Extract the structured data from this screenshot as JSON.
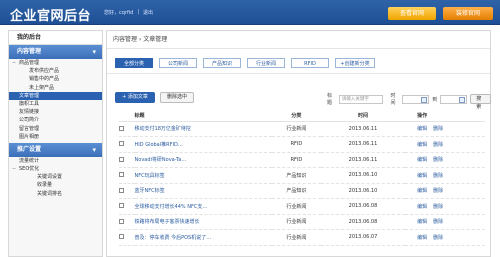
{
  "header": {
    "title": "企业官网后台",
    "user_greeting": "您好，",
    "user_name": "cqrfid",
    "logout": "退出",
    "view_site": "查看官网",
    "decorate_site": "装修官网"
  },
  "sidebar": {
    "title": "我的后台",
    "sections": [
      {
        "label": "内容管理",
        "items": [
          {
            "label": "商品管理",
            "level": 1,
            "expander": "−"
          },
          {
            "label": "发布供应产品",
            "level": 2
          },
          {
            "label": "销售中的产品",
            "level": 2
          },
          {
            "label": "未上架产品",
            "level": 2
          },
          {
            "label": "文章管理",
            "level": 1,
            "active": true
          },
          {
            "label": "旗帜工具",
            "level": 1
          },
          {
            "label": "友情链接",
            "level": 1
          },
          {
            "label": "公司简介",
            "level": 1
          },
          {
            "label": "留言管理",
            "level": 1
          },
          {
            "label": "图片相册",
            "level": 1
          }
        ]
      },
      {
        "label": "推广设置",
        "items": [
          {
            "label": "流量统计",
            "level": 1
          },
          {
            "label": "SEO优化",
            "level": 1,
            "expander": "−"
          },
          {
            "label": "关键词设置",
            "level": 2
          },
          {
            "label": "收录量",
            "level": 2
          },
          {
            "label": "关键词排名",
            "level": 2
          }
        ]
      }
    ]
  },
  "main": {
    "breadcrumb": "内容管理 › 文章管理",
    "tabs": [
      "全部分类",
      "公司新闻",
      "产品知识",
      "行业新闻",
      "RFID",
      "+创建新分类"
    ],
    "toolbar": {
      "add": "+ 添加文章",
      "delete": "删除选中",
      "title_label": "标题",
      "title_placeholder": "请输入关键字",
      "time_label": "时间",
      "to_label": "到",
      "search": "搜索"
    },
    "table": {
      "headers": [
        "标题",
        "分类",
        "时间",
        "操作"
      ],
      "rows": [
        {
          "title": "移动支付18万亿金矿待挖",
          "category": "行业新闻",
          "date": "2013.06.11"
        },
        {
          "title": "HID Global推RFID…",
          "category": "RFID",
          "date": "2013.06.11"
        },
        {
          "title": "Novadi将研Nova-Ta…",
          "category": "RFID",
          "date": "2013.06.11"
        },
        {
          "title": "NFC玩具标签",
          "category": "产品知识",
          "date": "2013.06.10"
        },
        {
          "title": "蓝牙NFC标签",
          "category": "产品知识",
          "date": "2013.06.10"
        },
        {
          "title": "全球移动支付增长44% NFC支…",
          "category": "行业新闻",
          "date": "2013.06.08"
        },
        {
          "title": "铁路将布局电子客票快速增长",
          "category": "行业新闻",
          "date": "2013.06.08"
        },
        {
          "title": "普及：停车收费 今后POS机说了…",
          "category": "行业新闻",
          "date": "2013.06.07"
        }
      ],
      "op_edit": "编辑",
      "op_delete": "删除"
    }
  }
}
